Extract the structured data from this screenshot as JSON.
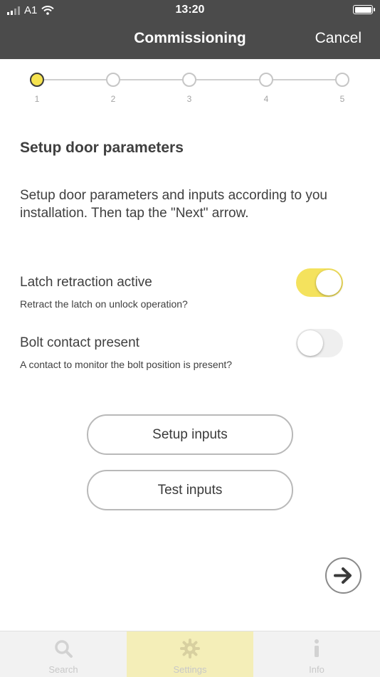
{
  "status_bar": {
    "carrier": "A1",
    "time": "13:20"
  },
  "header": {
    "title": "Commissioning",
    "cancel_label": "Cancel"
  },
  "stepper": {
    "steps": [
      "1",
      "2",
      "3",
      "4",
      "5"
    ],
    "active_step": 1
  },
  "page_title": "Setup door parameters",
  "description": "Setup door parameters and inputs according to you installation. Then tap the \"Next\" arrow.",
  "options": [
    {
      "label": "Latch retraction active",
      "sub": "Retract the latch on unlock operation?",
      "enabled": true
    },
    {
      "label": "Bolt contact present",
      "sub": "A contact to monitor the bolt position is present?",
      "enabled": false
    }
  ],
  "buttons": {
    "setup_inputs": "Setup inputs",
    "test_inputs": "Test inputs"
  },
  "next_icon": "arrow-right-icon",
  "tabs": [
    {
      "label": "Search",
      "icon": "search-icon"
    },
    {
      "label": "Settings",
      "icon": "gear-icon",
      "active": true
    },
    {
      "label": "Info",
      "icon": "info-icon"
    }
  ],
  "colors": {
    "header_bg": "#4b4b4b",
    "accent_yellow": "#f4e25d",
    "tab_active_bg": "#f4eeb8"
  }
}
